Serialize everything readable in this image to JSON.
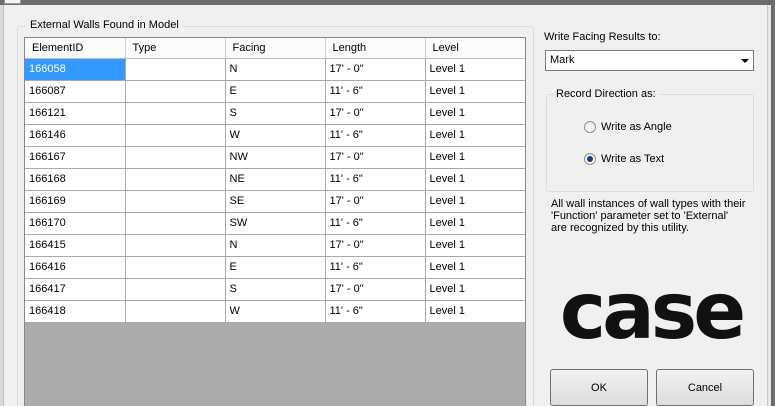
{
  "walls_group": {
    "title": "External Walls Found in Model",
    "columns": [
      "ElementID",
      "Type",
      "Facing",
      "Length",
      "Level"
    ],
    "rows": [
      [
        "166058",
        "",
        "N",
        "17' - 0\"",
        "Level 1"
      ],
      [
        "166087",
        "",
        "E",
        "11' - 6\"",
        "Level 1"
      ],
      [
        "166121",
        "",
        "S",
        "17' - 0\"",
        "Level 1"
      ],
      [
        "166146",
        "",
        "W",
        "11' - 6\"",
        "Level 1"
      ],
      [
        "166167",
        "",
        "NW",
        "17' - 0\"",
        "Level 1"
      ],
      [
        "166168",
        "",
        "NE",
        "11' - 6\"",
        "Level 1"
      ],
      [
        "166169",
        "",
        "SE",
        "17' - 0\"",
        "Level 1"
      ],
      [
        "166170",
        "",
        "SW",
        "11' - 6\"",
        "Level 1"
      ],
      [
        "166415",
        "",
        "N",
        "17' - 0\"",
        "Level 1"
      ],
      [
        "166416",
        "",
        "E",
        "11' - 6\"",
        "Level 1"
      ],
      [
        "166417",
        "",
        "S",
        "17' - 0\"",
        "Level 1"
      ],
      [
        "166418",
        "",
        "W",
        "11' - 6\"",
        "Level 1"
      ]
    ]
  },
  "write_results": {
    "label": "Write Facing Results to:",
    "selected": "Mark"
  },
  "record_direction": {
    "title": "Record Direction as:",
    "options": [
      {
        "label": "Write as Angle",
        "checked": false
      },
      {
        "label": "Write as Text",
        "checked": true
      }
    ]
  },
  "info_lines": [
    "All wall instances of wall types with their",
    "'Function' parameter set to 'External'",
    "are recognized by this utility."
  ],
  "logo_text": "case",
  "buttons": {
    "ok": "OK",
    "cancel": "Cancel"
  },
  "colors": {
    "selection": "#3399ff",
    "grid_background": "#ababab",
    "dialog_background": "#f0f0f0"
  }
}
